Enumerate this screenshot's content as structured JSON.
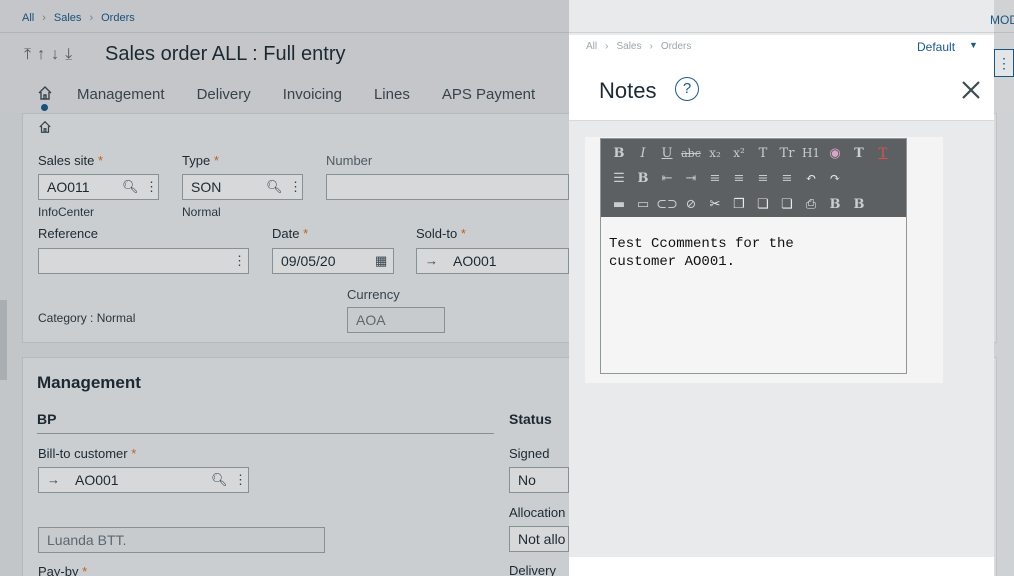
{
  "breadcrumb": {
    "items": [
      "All",
      "Sales",
      "Orders"
    ]
  },
  "top_right_link": "MOD",
  "header": {
    "title": "Sales order ALL : Full entry",
    "nav_arrows": [
      "⤒",
      "↑",
      "↓",
      "⤓"
    ]
  },
  "tabs": [
    "Management",
    "Delivery",
    "Invoicing",
    "Lines",
    "APS Payment"
  ],
  "form": {
    "sales_site": {
      "label": "Sales site",
      "value": "AO011",
      "sub": "InfoCenter"
    },
    "type": {
      "label": "Type",
      "value": "SON",
      "sub": "Normal"
    },
    "number": {
      "label": "Number",
      "value": ""
    },
    "reference": {
      "label": "Reference",
      "value": ""
    },
    "date": {
      "label": "Date",
      "value": "09/05/20"
    },
    "sold_to": {
      "label": "Sold-to",
      "value": "AO001"
    },
    "category": "Category : Normal",
    "currency": {
      "label": "Currency",
      "value": "AOA"
    }
  },
  "management": {
    "title": "Management",
    "bp_heading": "BP",
    "status_heading": "Status",
    "bill_to": {
      "label": "Bill-to customer",
      "value": "AO001"
    },
    "bill_to_name": "Luanda BTT.",
    "pay_by_label": "Pay-by",
    "signed": {
      "label": "Signed",
      "value": "No"
    },
    "allocation": {
      "label": "Allocation",
      "value": "Not allo"
    },
    "delivery_label": "Delivery"
  },
  "notes_panel": {
    "breadcrumb": [
      "All",
      "Sales",
      "Orders"
    ],
    "default_label": "Default",
    "title": "Notes",
    "help": "?",
    "text_line1": "Test Ccomments for the",
    "text_line2": "customer AO001."
  },
  "colors": {
    "accent": "#1a5a8a",
    "required": "#e0701d",
    "toolbar": "#5d6063"
  }
}
